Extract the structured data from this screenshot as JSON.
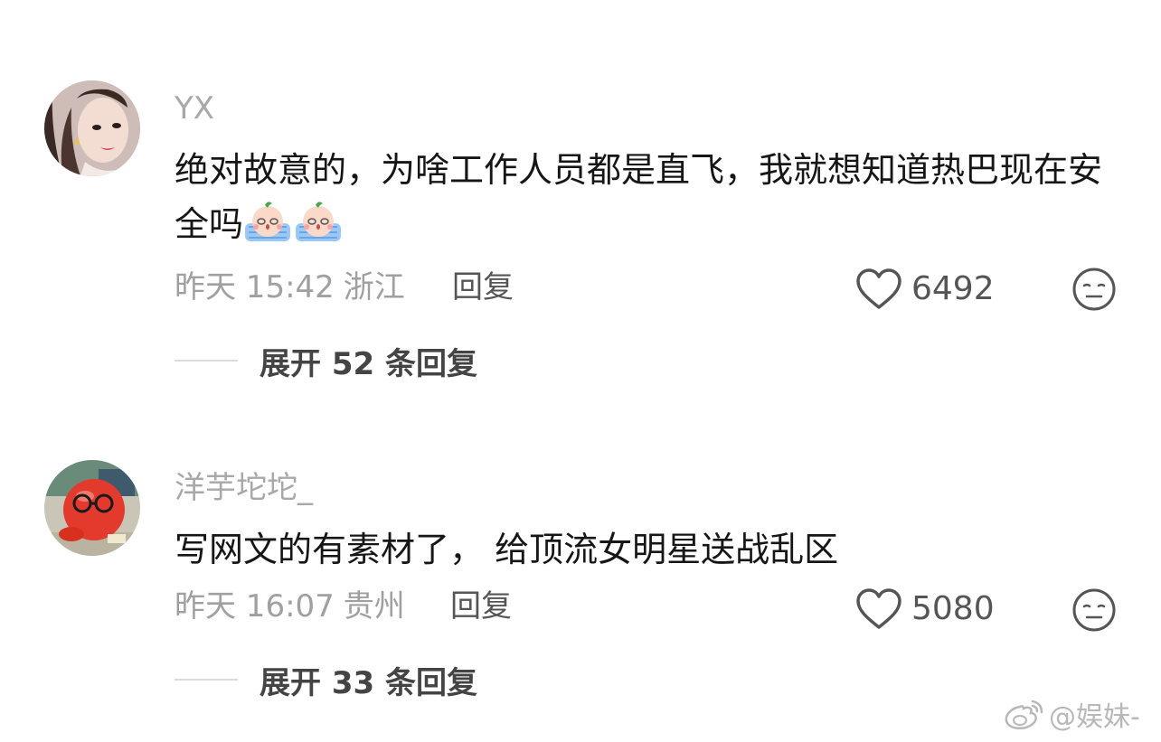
{
  "comments": [
    {
      "username": "YX",
      "text": "绝对故意的，为啥工作人员都是直飞，我就想知道热巴现在安全吗",
      "emojis": [
        "crying-emoji",
        "crying-emoji"
      ],
      "time": "昨天 15:42",
      "location": "浙江",
      "reply_label": "回复",
      "likes": "6492",
      "expand_label": "展开 52 条回复",
      "avatar_icon": "avatar-woman-photo"
    },
    {
      "username": "洋芋坨坨_",
      "text": "写网文的有素材了， 给顶流女明星送战乱区",
      "emojis": [],
      "time": "昨天 16:07",
      "location": "贵州",
      "reply_label": "回复",
      "likes": "5080",
      "expand_label": "展开 33 条回复",
      "avatar_icon": "avatar-red-ball-photo"
    }
  ],
  "watermark": {
    "text": "@娱妹-",
    "icon": "weibo-logo-icon"
  },
  "colors": {
    "username": "#a8a8a8",
    "text": "#161616",
    "meta": "#a0a0a0",
    "action": "#555555",
    "expand": "#444444"
  }
}
